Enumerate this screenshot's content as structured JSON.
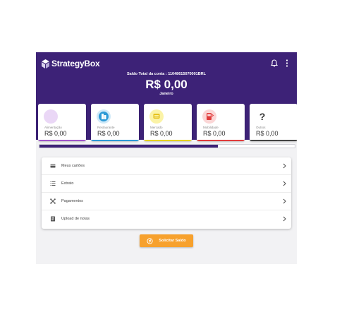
{
  "header": {
    "brand": "StrategyBox",
    "balance_label": "Saldo Total da conta : 11048615070001BRL",
    "balance_value": "R$ 0,00",
    "month": "Janeiro"
  },
  "categories": [
    {
      "label": "Alimentação",
      "value": "R$ 0,00",
      "icon": "meal-icon",
      "color": "#a055c9",
      "icon_bg": "#ead7f6"
    },
    {
      "label": "Restaurante",
      "value": "R$ 0,00",
      "icon": "building-icon",
      "color": "#2d9ad6",
      "icon_bg": "#cfe9f8"
    },
    {
      "label": "Mercado",
      "value": "R$ 0,00",
      "icon": "cart-icon",
      "color": "#e6d21f",
      "icon_bg": "#fbf3a6"
    },
    {
      "label": "Mobilidade",
      "value": "R$ 0,00",
      "icon": "bus-icon",
      "color": "#e03c3c",
      "icon_bg": "#fbd6d6"
    },
    {
      "label": "Outros",
      "value": "R$ 0,00",
      "icon": "question-icon",
      "color": "#444444",
      "icon_bg": "#ffffff"
    }
  ],
  "progress": {
    "fraction": 0.7
  },
  "menu": {
    "items": [
      {
        "label": "Meus cartões",
        "icon": "card-icon"
      },
      {
        "label": "Extrato",
        "icon": "list-icon"
      },
      {
        "label": "Pagamentos",
        "icon": "payments-icon"
      },
      {
        "label": "Upload de notas",
        "icon": "receipt-icon"
      }
    ]
  },
  "cta": {
    "label": "Solicitar Saldo",
    "icon": "exchange-icon"
  },
  "colors": {
    "primary": "#3d2277",
    "accent": "#f7a12d"
  }
}
